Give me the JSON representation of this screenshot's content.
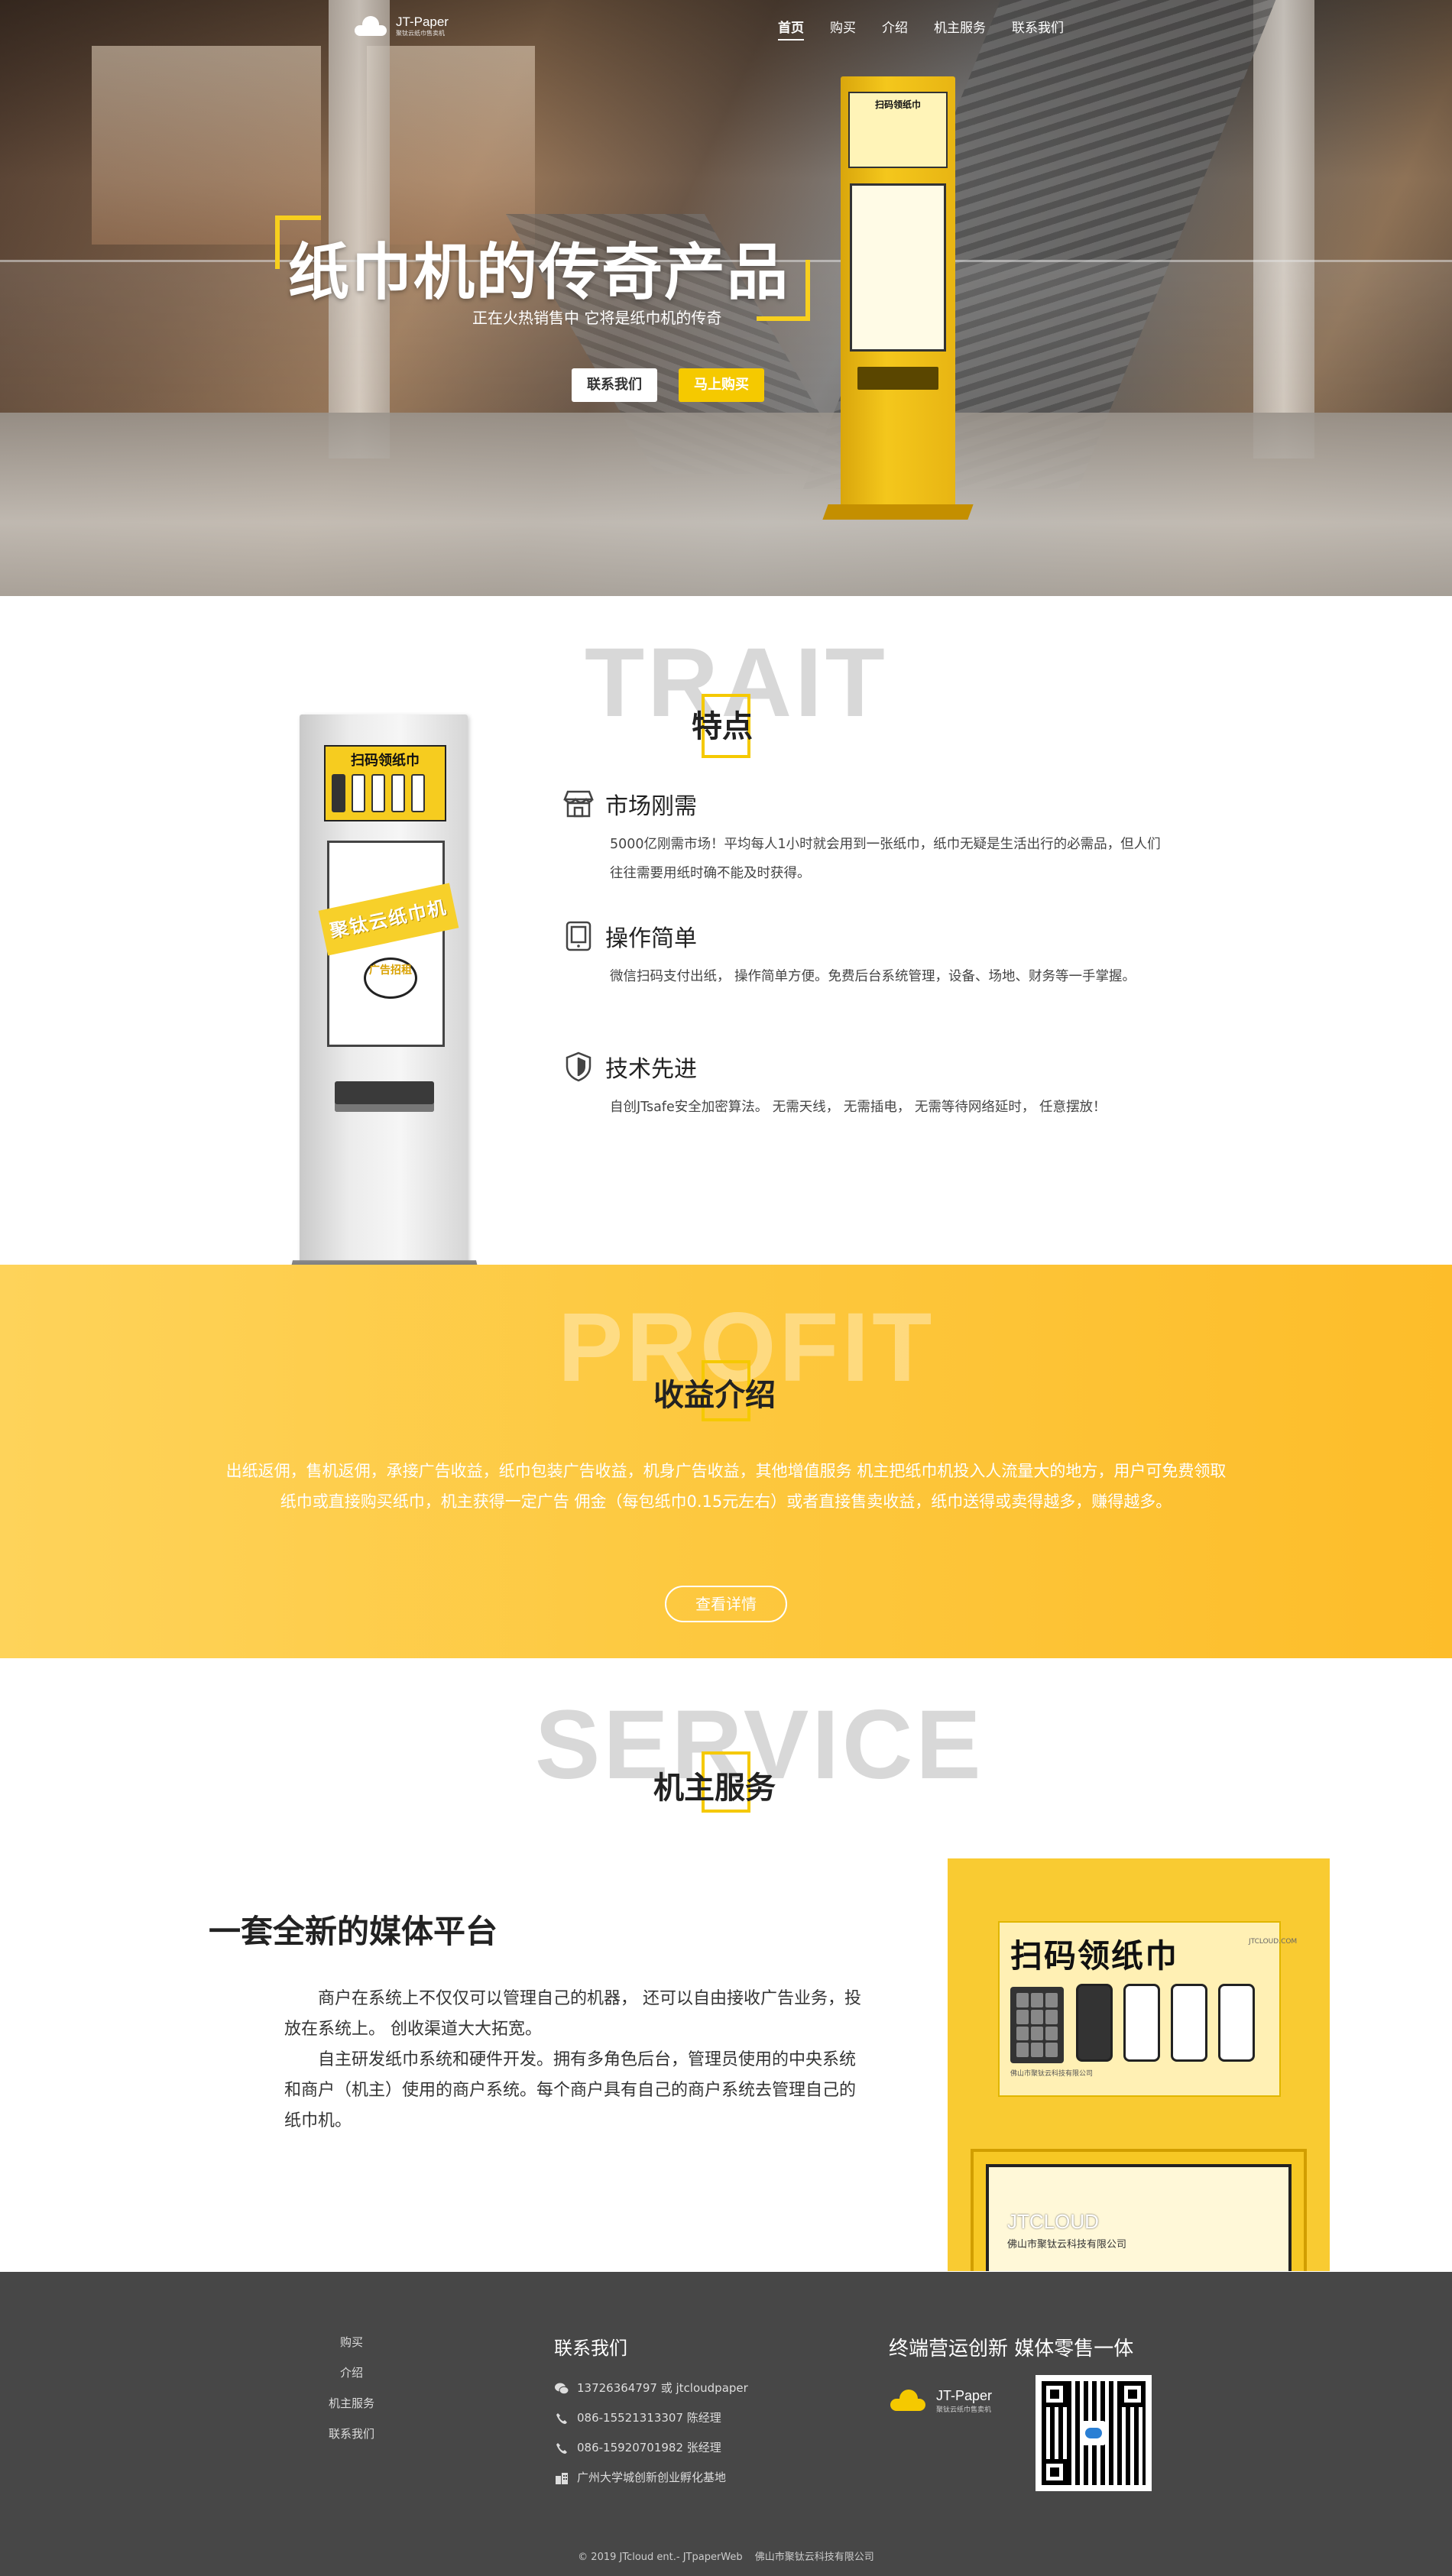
{
  "nav": {
    "logo_title": "JT-Paper",
    "logo_subtitle": "聚钛云纸巾售卖机",
    "items": [
      {
        "label": "首页",
        "active": true
      },
      {
        "label": "购买",
        "active": false
      },
      {
        "label": "介绍",
        "active": false
      },
      {
        "label": "机主服务",
        "active": false
      },
      {
        "label": "联系我们",
        "active": false
      }
    ]
  },
  "hero": {
    "title": "纸巾机的传奇产品",
    "subtitle": "正在火热销售中 它将是纸巾机的传奇",
    "contact_button": "联系我们",
    "buy_button": "马上购买",
    "kiosk_top_text": "扫码领纸巾"
  },
  "trait": {
    "bg_word": "TRAIT",
    "title": "特点",
    "kiosk": {
      "head_title": "扫码领纸巾",
      "band_text": "聚钛云纸巾机",
      "bubble_text": "广告招租"
    },
    "features": [
      {
        "icon": "store-icon",
        "title": "市场刚需",
        "text": "5000亿刚需市场！平均每人1小时就会用到一张纸巾，纸巾无疑是生活出行的必需品，但人们往往需要用纸时确不能及时获得。"
      },
      {
        "icon": "tablet-icon",
        "title": "操作简单",
        "text": "微信扫码支付出纸， 操作简单方便。免费后台系统管理，设备、场地、财务等一手掌握。"
      },
      {
        "icon": "shield-icon",
        "title": "技术先进",
        "text": "自创JTsafe安全加密算法。 无需天线， 无需插电， 无需等待网络延时， 任意摆放！"
      }
    ]
  },
  "profit": {
    "bg_word": "PROFIT",
    "title": "收益介绍",
    "text": "出纸返佣，售机返佣，承接广告收益，纸巾包装广告收益，机身广告收益，其他增值服务 机主把纸巾机投入人流量大的地方，用户可免费领取纸巾或直接购买纸巾，机主获得一定广告 佣金（每包纸巾0.15元左右）或者直接售卖收益，纸巾送得或卖得越多，赚得越多。",
    "button": "查看详情"
  },
  "service": {
    "bg_word": "SERVICE",
    "title": "机主服务",
    "heading": "一套全新的媒体平台",
    "paragraphs": [
      "商户在系统上不仅仅可以管理自己的机器， 还可以自由接收广告业务，投放在系统上。 创收渠道大大拓宽。",
      "自主研发纸巾系统和硬件开发。拥有多角色后台，管理员使用的中央系统和商户（机主）使用的商户系统。每个商户具有自己的商户系统去管理自己的纸巾机。"
    ],
    "image": {
      "panel_title": "扫码领纸巾",
      "panel_brand": "JTCLOUD.COM",
      "panel_company": "佛山市聚钛云科技有限公司",
      "board_brand": "JTCLOUD",
      "board_company": "佛山市聚钛云科技有限公司"
    }
  },
  "footer": {
    "links": [
      "购买",
      "介绍",
      "机主服务",
      "联系我们"
    ],
    "contact_title": "联系我们",
    "contacts": [
      {
        "icon": "wechat-icon",
        "text": "13726364797 或 jtcloudpaper"
      },
      {
        "icon": "phone-icon",
        "text": "086-15521313307 陈经理"
      },
      {
        "icon": "phone-icon",
        "text": "086-15920701982 张经理"
      },
      {
        "icon": "building-icon",
        "text": "广州大学城创新创业孵化基地"
      }
    ],
    "slogan": "终端营运创新 媒体零售一体",
    "logo_title": "JT-Paper",
    "logo_subtitle": "聚钛云纸巾售卖机",
    "copyright": "© 2019 JTcloud ent.- JTpaperWeb",
    "company": "佛山市聚钛云科技有限公司"
  },
  "colors": {
    "accent": "#f5c900",
    "footer_bg": "#474747",
    "profit_bg": "#fdc83e"
  }
}
